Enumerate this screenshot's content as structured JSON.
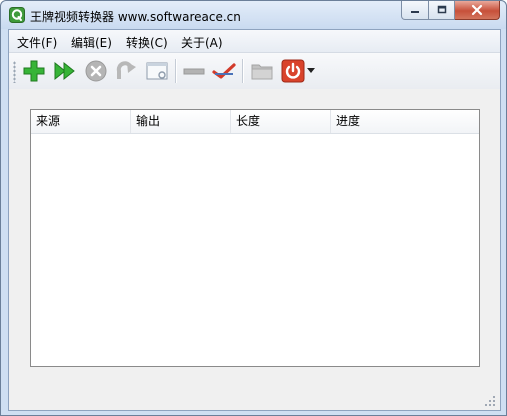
{
  "window": {
    "title": "王牌视频转换器  www.softwareace.cn"
  },
  "menu": [
    {
      "label": "文件(F)"
    },
    {
      "label": "编辑(E)"
    },
    {
      "label": "转换(C)"
    },
    {
      "label": "关于(A)"
    }
  ],
  "toolbar": {
    "buttons": [
      {
        "icon": "add-icon",
        "color": "#2fa82f"
      },
      {
        "icon": "convert-forward-icon",
        "color": "#2fa82f"
      },
      {
        "icon": "stop-icon",
        "color": "#b0b0b0"
      },
      {
        "icon": "redo-icon",
        "color": "#b0b0b0"
      },
      {
        "icon": "window-settings-icon",
        "color": "#9aa7b6"
      },
      {
        "icon": "remove-icon",
        "color": "#b0b0b0"
      },
      {
        "icon": "check-clear-icon",
        "color": "#c0392b"
      },
      {
        "icon": "folder-icon",
        "color": "#b7b7b7"
      },
      {
        "icon": "power-icon",
        "color": "#d9432b"
      }
    ]
  },
  "list": {
    "columns": [
      "来源",
      "输出",
      "长度",
      "进度"
    ],
    "rows": []
  }
}
